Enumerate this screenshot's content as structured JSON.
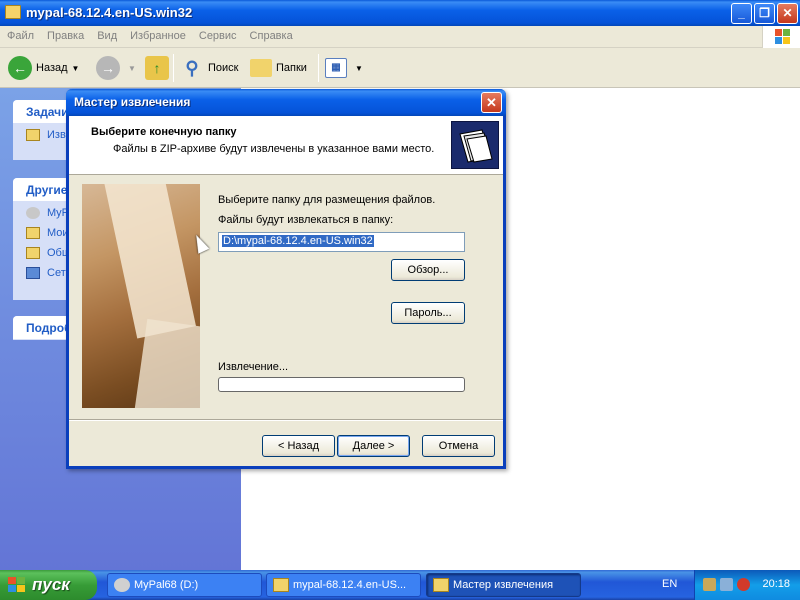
{
  "explorer": {
    "title": "mypal-68.12.4.en-US.win32",
    "menu": [
      "Файл",
      "Правка",
      "Вид",
      "Избранное",
      "Сервис",
      "Справка"
    ],
    "toolbar": {
      "back": "Назад",
      "search": "Поиск",
      "folders": "Папки"
    },
    "taskpane": {
      "tasks_title": "Задачи",
      "tasks_item": "Изв",
      "other_title": "Другие",
      "other_items": [
        "MyP",
        "Мои",
        "Общ",
        "Сет"
      ],
      "details_title": "Подроб"
    }
  },
  "wizard": {
    "title": "Мастер извлечения",
    "header_title": "Выберите конечную папку",
    "header_subtitle": "Файлы в ZIP-архиве будут извлечены в указанное вами место.",
    "choose_folder_label": "Выберите папку для размещения файлов.",
    "extract_to_label": "Файлы будут извлекаться в папку:",
    "path_value": "D:\\mypal-68.12.4.en-US.win32",
    "browse_button": "Обзор...",
    "password_button": "Пароль...",
    "extracting_label": "Извлечение...",
    "progress": 0,
    "back_button": "< Назад",
    "next_button": "Далее >",
    "cancel_button": "Отмена"
  },
  "taskbar": {
    "start": "пуск",
    "tasks": [
      "MyPal68 (D:)",
      "mypal-68.12.4.en-US...",
      "Мастер извлечения"
    ],
    "language": "EN",
    "clock": "20:18"
  }
}
